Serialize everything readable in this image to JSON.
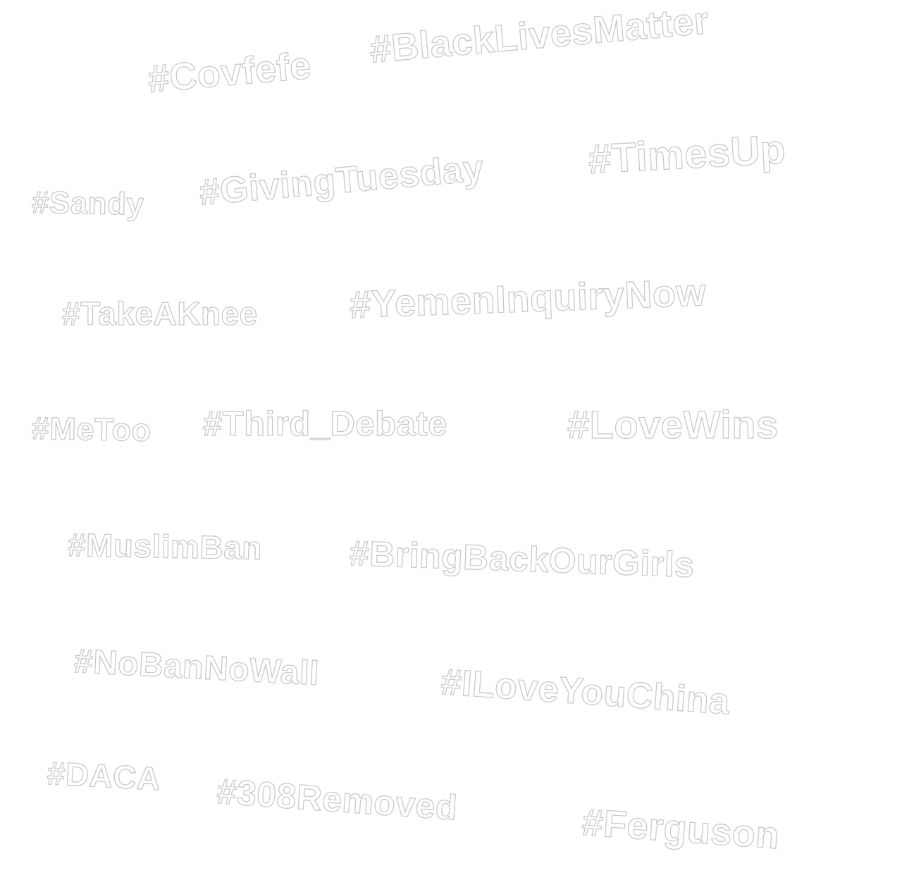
{
  "hashtags": [
    "#Covfefe",
    "#BlackLivesMatter",
    "#Sandy",
    "#GivingTuesday",
    "#TimesUp",
    "#TakeAKnee",
    "#YemenInquiryNow",
    "#MeToo",
    "#Third_Debate",
    "#LoveWins",
    "#MuslimBan",
    "#BringBackOurGirls",
    "#NoBanNoWall",
    "#ILoveYouChina",
    "#DACA",
    "#308Removed",
    "#Ferguson"
  ],
  "colors": {
    "background": "#ffffff",
    "text_fill": "#ffffff",
    "text_outline": "#c9c9c9"
  }
}
